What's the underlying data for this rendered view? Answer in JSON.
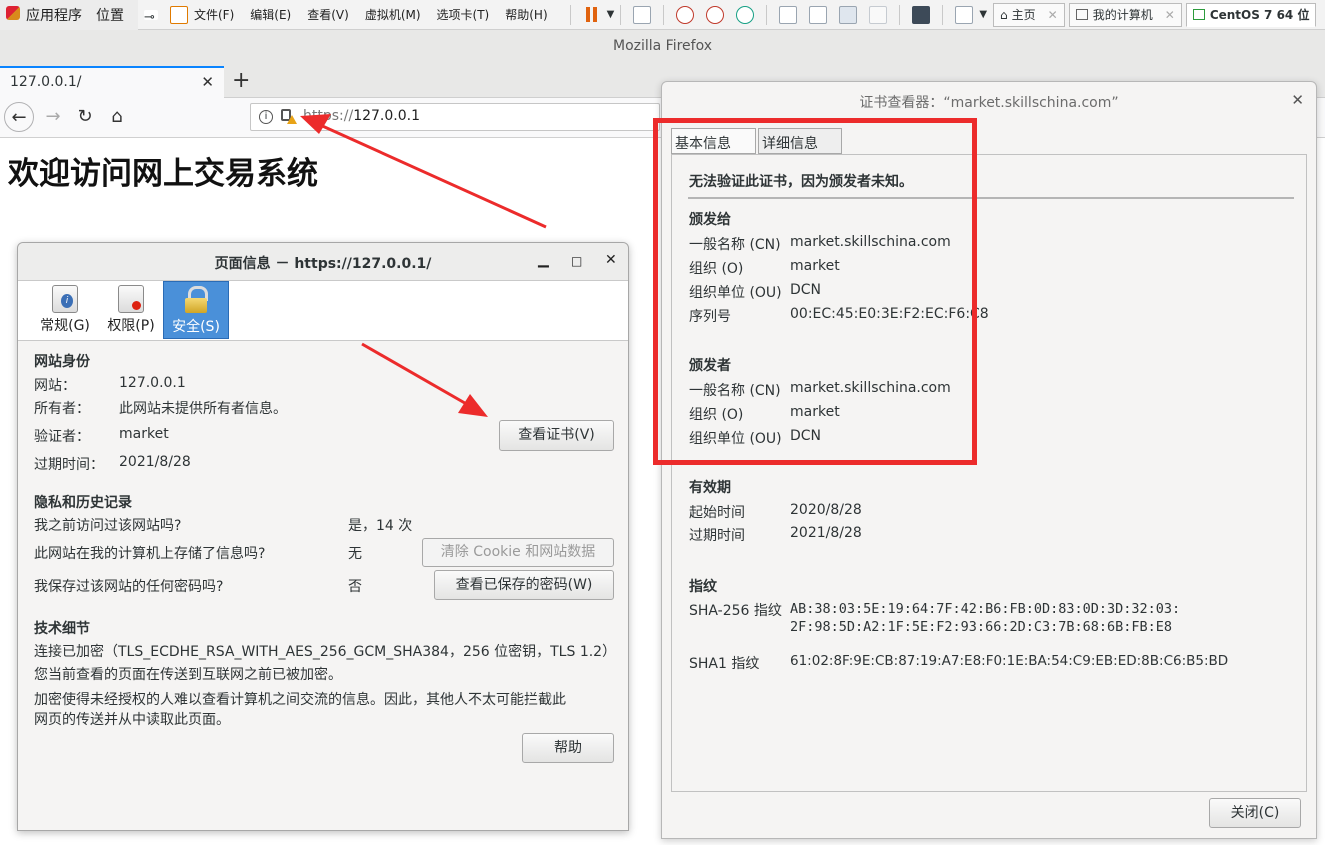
{
  "vm_toolbar": {
    "gnome_apps": "应用程序",
    "gnome_places": "位置",
    "menu": [
      "文件(F)",
      "编辑(E)",
      "查看(V)",
      "虚拟机(M)",
      "选项卡(T)",
      "帮助(H)"
    ],
    "tabs": [
      {
        "label": "主页",
        "icon": "home-icon"
      },
      {
        "label": "我的计算机",
        "icon": "computer-icon"
      },
      {
        "label": "CentOS 7 64 位",
        "icon": "vm-icon"
      }
    ]
  },
  "firefox": {
    "window_title": "Mozilla Firefox",
    "tab_title": "127.0.0.1/",
    "url_scheme": "https://",
    "url_host": "127.0.0.1",
    "page_heading": "欢迎访问网上交易系统"
  },
  "page_info": {
    "title": "页面信息 － https://127.0.0.1/",
    "tabs": [
      "常规(G)",
      "权限(P)",
      "安全(S)"
    ],
    "identity_heading": "网站身份",
    "website_label": "网站：",
    "website_value": "127.0.0.1",
    "owner_label": "所有者：",
    "owner_value": "此网站未提供所有者信息。",
    "verifier_label": "验证者：",
    "verifier_value": "market",
    "expiry_label": "过期时间：",
    "expiry_value": "2021/8/28",
    "view_cert_button": "查看证书(V)",
    "privacy_heading": "隐私和历史记录",
    "q_visited": "我之前访问过该网站吗?",
    "a_visited": "是，14 次",
    "q_stored": "此网站在我的计算机上存储了信息吗?",
    "a_stored": "无",
    "clear_button": "清除 Cookie 和网站数据",
    "q_password": "我保存过该网站的任何密码吗?",
    "a_password": "否",
    "saved_pw_button": "查看已保存的密码(W)",
    "tech_heading": "技术细节",
    "tech_line1": "连接已加密（TLS_ECDHE_RSA_WITH_AES_256_GCM_SHA384，256 位密钥，TLS 1.2）",
    "tech_line2": "您当前查看的页面在传送到互联网之前已被加密。",
    "tech_line3": "加密使得未经授权的人难以查看计算机之间交流的信息。因此，其他人不太可能拦截此",
    "tech_line4": "网页的传送并从中读取此页面。",
    "help_button": "帮助"
  },
  "cert_viewer": {
    "title": "证书查看器：“market.skillschina.com”",
    "tab_basic": "基本信息(G)",
    "tab_detail": "详细信息(D)",
    "warning": "无法验证此证书，因为颁发者未知。",
    "issued_to_heading": "颁发给",
    "issued_by_heading": "颁发者",
    "cn_label": "一般名称 (CN)",
    "o_label": "组织 (O)",
    "ou_label": "组织单位 (OU)",
    "serial_label": "序列号",
    "to_cn": "market.skillschina.com",
    "to_o": "market",
    "to_ou": "DCN",
    "to_serial": "00:EC:45:E0:3E:F2:EC:F6:C8",
    "by_cn": "market.skillschina.com",
    "by_o": "market",
    "by_ou": "DCN",
    "validity_heading": "有效期",
    "start_label": "起始时间",
    "start_value": "2020/8/28",
    "end_label": "过期时间",
    "end_value": "2021/8/28",
    "fp_heading": "指纹",
    "sha256_label": "SHA-256 指纹",
    "sha256_line1": "AB:38:03:5E:19:64:7F:42:B6:FB:0D:83:0D:3D:32:03:",
    "sha256_line2": "2F:98:5D:A2:1F:5E:F2:93:66:2D:C3:7B:68:6B:FB:E8",
    "sha1_label": "SHA1 指纹",
    "sha1_value": "61:02:8F:9E:CB:87:19:A7:E8:F0:1E:BA:54:C9:EB:ED:8B:C6:B5:BD",
    "close_button": "关闭(C)"
  },
  "colors": {
    "annotation": "#ec2b2b",
    "accent": "#4a90d9"
  }
}
